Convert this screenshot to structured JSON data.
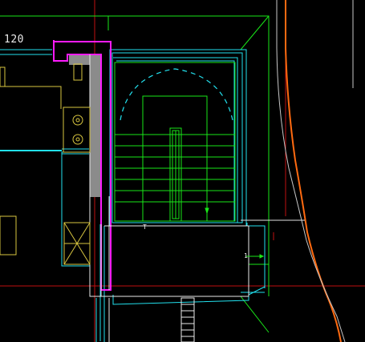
{
  "drawing": {
    "dimension_label": "120",
    "up_arrow_mark_1": "T",
    "up_arrow_mark_2": "1"
  },
  "colors": {
    "background": "#000000",
    "green": "#19e619",
    "cyan": "#22e1ee",
    "magenta": "#ff1bff",
    "red": "#c11010",
    "orange": "#ff6a10",
    "white": "#f0f0f0",
    "yellow": "#d8c640",
    "grey_fill": "#8b8b8b"
  }
}
